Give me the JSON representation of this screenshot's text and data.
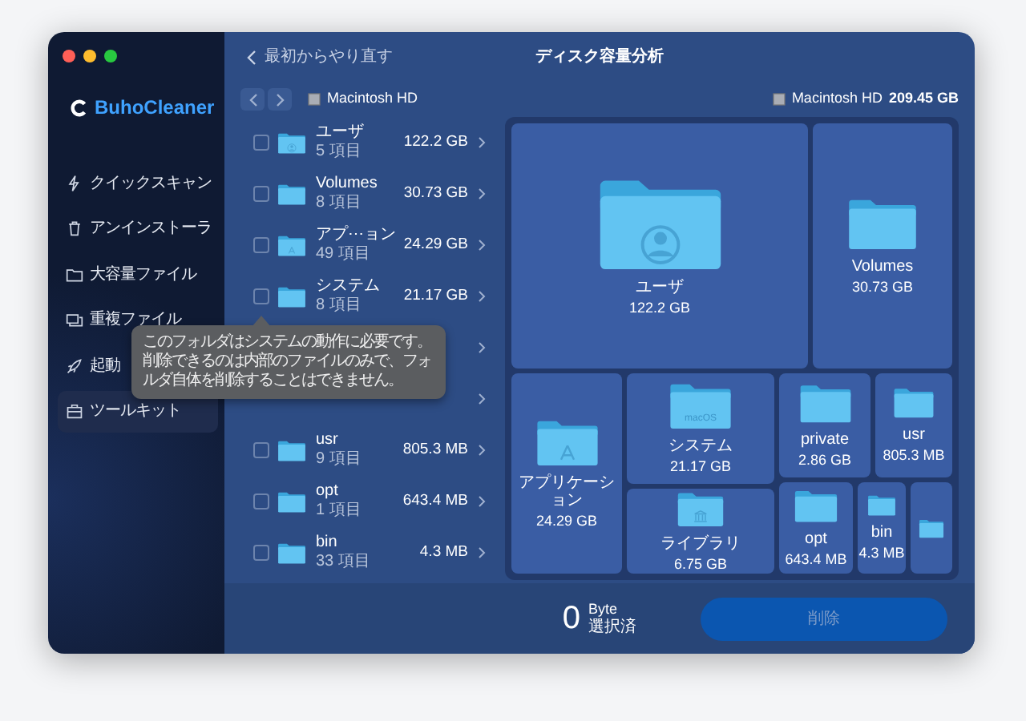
{
  "sidebar": {
    "logo": "BuhoCleaner",
    "items": [
      {
        "label": "クイックスキャン",
        "kind": "bolt",
        "selected": false
      },
      {
        "label": "アンインストーラ",
        "kind": "trash",
        "selected": false
      },
      {
        "label": "大容量ファイル",
        "kind": "folder",
        "selected": false
      },
      {
        "label": "重複ファイル",
        "kind": "copies",
        "selected": false
      },
      {
        "label": "起動",
        "kind": "rocket",
        "selected": false
      },
      {
        "label": "ツールキット",
        "kind": "toolbox",
        "selected": true
      }
    ]
  },
  "header": {
    "back_link": "最初からやり直す",
    "title": "ディスク容量分析"
  },
  "path": {
    "disk": "Macintosh HD"
  },
  "disk_summary": {
    "name": "Macintosh HD",
    "size": "209.45 GB"
  },
  "list": [
    {
      "name": "ユーザ",
      "count": "5 項目",
      "size": "122.2 GB",
      "kind": "user",
      "checked": false
    },
    {
      "name": "Volumes",
      "count": "8 項目",
      "size": "30.73 GB",
      "kind": "folder",
      "checked": false
    },
    {
      "name": "アプ⋯ョン",
      "count": "49 項目",
      "size": "24.29 GB",
      "kind": "apps",
      "checked": false
    },
    {
      "name": "システム",
      "count": "8 項目",
      "size": "21.17 GB",
      "kind": "macos",
      "checked": false
    },
    {
      "kind": "hidden"
    },
    {
      "kind": "hidden"
    },
    {
      "name": "usr",
      "count": "9 項目",
      "size": "805.3 MB",
      "kind": "folder",
      "checked": false
    },
    {
      "name": "opt",
      "count": "1 項目",
      "size": "643.4 MB",
      "kind": "folder",
      "checked": false
    },
    {
      "name": "bin",
      "count": "33 項目",
      "size": "4.3 MB",
      "kind": "folder",
      "checked": false
    }
  ],
  "tooltip": "このフォルダはシステムの動作に必要です。削除できるのは内部のファイルのみで、フォルダ自体を削除することはできません。",
  "treemap": [
    {
      "name": "ユーザ",
      "size": "122.2 GB",
      "kind": "user"
    },
    {
      "name": "Volumes",
      "size": "30.73 GB",
      "kind": "folder"
    },
    {
      "name": "アプリケーション",
      "size": "24.29 GB",
      "kind": "apps"
    },
    {
      "name": "システム",
      "size": "21.17 GB",
      "kind": "macos",
      "badge": "macOS"
    },
    {
      "name": "ライブラリ",
      "size": "6.75 GB",
      "kind": "library"
    },
    {
      "name": "private",
      "size": "2.86 GB",
      "kind": "folder"
    },
    {
      "name": "usr",
      "size": "805.3 MB",
      "kind": "folder"
    },
    {
      "name": "opt",
      "size": "643.4 MB",
      "kind": "folder"
    },
    {
      "name": "bin",
      "size": "4.3 MB",
      "kind": "folder"
    },
    {
      "kind": "folder"
    }
  ],
  "footer": {
    "selected_size": "0",
    "unit": "Byte",
    "label": "選択済",
    "delete_button": "削除",
    "disabled": true
  }
}
